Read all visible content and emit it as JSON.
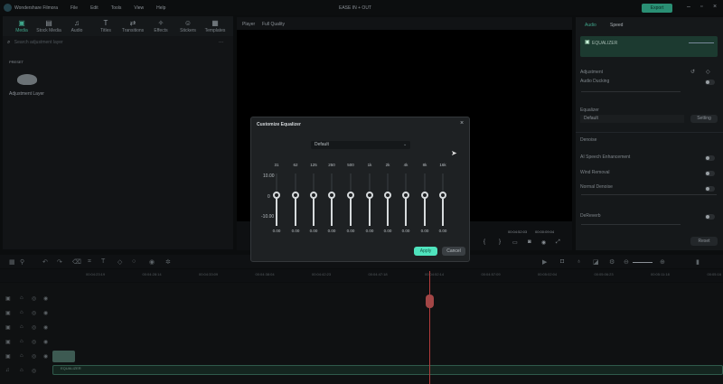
{
  "app": {
    "name": "Wondershare Filmora",
    "project_title": "EASE IN + OUT",
    "menu": [
      "File",
      "Edit",
      "Tools",
      "View",
      "Help"
    ],
    "export_label": "Export",
    "accent": "#3fd9b0"
  },
  "left_panel": {
    "tabs": [
      {
        "label": "Media",
        "icon": "media-icon"
      },
      {
        "label": "Stock Media",
        "icon": "stock-media-icon"
      },
      {
        "label": "Audio",
        "icon": "music-note-icon"
      },
      {
        "label": "Titles",
        "icon": "text-icon"
      },
      {
        "label": "Transitions",
        "icon": "transitions-icon"
      },
      {
        "label": "Effects",
        "icon": "effects-icon"
      },
      {
        "label": "Stickers",
        "icon": "stickers-icon"
      },
      {
        "label": "Templates",
        "icon": "templates-icon"
      }
    ],
    "search_placeholder": "Search adjustment layer",
    "section": "PRESET",
    "item_label": "Adjustment Layer"
  },
  "player": {
    "label": "Player",
    "quality": "Full Quality",
    "current_time": "00:04:52:03",
    "duration": "00:00:09:04"
  },
  "right_panel": {
    "tabs": [
      "Audio",
      "Speed"
    ],
    "clip_name": "EQUALIZER",
    "adjustment": "Adjustment",
    "audio_ducking": "Audio Ducking",
    "equalizer": "Equalizer",
    "equalizer_preset": "Default",
    "setting": "Setting",
    "denoise": "Denoise",
    "ai_speech": "AI Speech Enhancement",
    "wind_removal": "Wind Removal",
    "normal_denoise": "Normal Denoise",
    "dereverb": "DeReverb",
    "reset": "Reset"
  },
  "dialog": {
    "title": "Customize Equalizer",
    "preset": "Default",
    "y_labels": [
      "10.00",
      "0",
      "-10.00"
    ],
    "bands": [
      {
        "freq": "31",
        "value": "0.00"
      },
      {
        "freq": "62",
        "value": "0.00"
      },
      {
        "freq": "125",
        "value": "0.00"
      },
      {
        "freq": "250",
        "value": "0.00"
      },
      {
        "freq": "500",
        "value": "0.00"
      },
      {
        "freq": "1k",
        "value": "0.00"
      },
      {
        "freq": "2k",
        "value": "0.00"
      },
      {
        "freq": "4k",
        "value": "0.00"
      },
      {
        "freq": "8k",
        "value": "0.00"
      },
      {
        "freq": "16k",
        "value": "0.00"
      }
    ],
    "apply": "Apply",
    "cancel": "Cancel"
  },
  "timeline": {
    "ruler": [
      "00:04:23:19",
      "00:04:28:14",
      "00:04:33:09",
      "00:04:38:04",
      "00:04:42:23",
      "00:04:47:18",
      "00:04:52:14",
      "00:04:57:09",
      "00:05:02:04",
      "00:05:06:23",
      "00:05:11:18",
      "00:05:16"
    ],
    "audio_clip": "EQUALIZER"
  }
}
